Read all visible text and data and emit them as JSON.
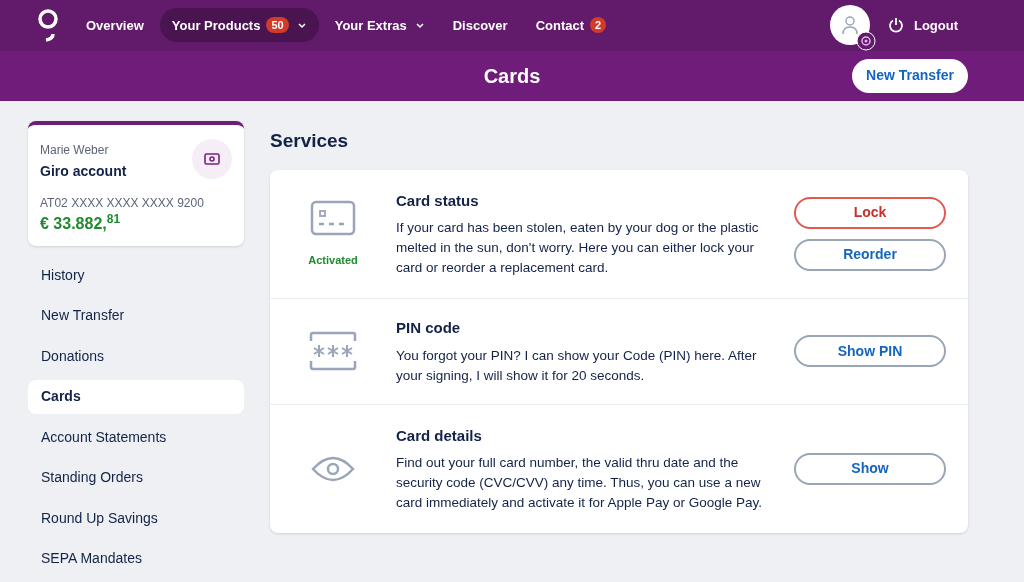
{
  "nav": {
    "items": [
      {
        "label": "Overview",
        "selected": false
      },
      {
        "label": "Your Products",
        "badge": "50",
        "dropdown": true,
        "selected": true
      },
      {
        "label": "Your Extras",
        "dropdown": true,
        "selected": false
      },
      {
        "label": "Discover",
        "selected": false
      },
      {
        "label": "Contact",
        "badge": "2",
        "selected": false
      }
    ],
    "logout": "Logout"
  },
  "header": {
    "title": "Cards",
    "action": "New Transfer"
  },
  "account": {
    "owner": "Marie Weber",
    "name": "Giro account",
    "iban": "AT02 XXXX XXXX XXXX 9200",
    "balance": "€ 33.882,$^{81}$"
  },
  "sidebar": {
    "items": [
      {
        "label": "History",
        "selected": false
      },
      {
        "label": "New Transfer",
        "selected": false
      },
      {
        "label": "Donations",
        "selected": false
      },
      {
        "label": "Cards",
        "selected": true
      },
      {
        "label": "Account Statements",
        "selected": false
      },
      {
        "label": "Standing Orders",
        "selected": false
      },
      {
        "label": "Round Up Savings",
        "selected": false
      },
      {
        "label": "SEPA Mandates",
        "selected": false
      }
    ]
  },
  "services": {
    "title": "Services",
    "items": [
      {
        "kind": "card",
        "title": "Card status",
        "status": "Activated",
        "text": "If your card has been stolen, eaten by your dog or the plastic melted in the sun, don't worry. Here you can either lock your card or reorder a replacement card.",
        "buttons": [
          {
            "label": "Lock",
            "kind": "danger"
          },
          {
            "label": "Reorder",
            "kind": "primary"
          }
        ]
      },
      {
        "kind": "pin",
        "title": "PIN code",
        "text": "You forgot your PIN? I can show your Code (PIN) here. After your signing, I will show it for 20 seconds.",
        "buttons": [
          {
            "label": "Show PIN",
            "kind": "primary"
          }
        ]
      },
      {
        "kind": "eye",
        "title": "Card details",
        "text": "Find out your full card number, the valid thru date and the security code (CVC/CVV) any time. Thus, you can use a new card immediately and activate it for Apple Pay or Google Pay.",
        "buttons": [
          {
            "label": "Show",
            "kind": "primary"
          }
        ]
      }
    ]
  }
}
